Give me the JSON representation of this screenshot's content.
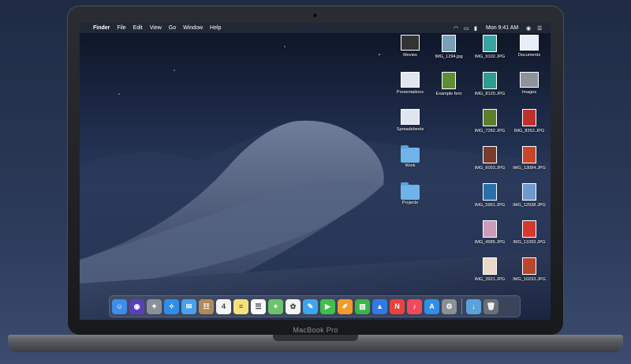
{
  "menubar": {
    "apple_glyph": "",
    "items": [
      "Finder",
      "File",
      "Edit",
      "View",
      "Go",
      "Window",
      "Help"
    ],
    "clock": "Mon 9:41 AM"
  },
  "desktop": {
    "col1": [
      {
        "label": "Movies",
        "kind": "movies"
      },
      {
        "label": "Presentations",
        "kind": "presentations"
      },
      {
        "label": "Spreadsheets",
        "kind": "spreadsheets"
      },
      {
        "label": "Work",
        "kind": "folder"
      },
      {
        "label": "Projects",
        "kind": "folder"
      }
    ],
    "col2": [
      {
        "label": "IMG_1294.jpg",
        "color": "#7aa0b6"
      },
      {
        "label": "Example fern",
        "color": "#5c8f35"
      }
    ],
    "col3": [
      {
        "label": "IMG_9102.JPG",
        "color": "#3aa3a0"
      },
      {
        "label": "IMG_8120.JPG",
        "color": "#2e9c8f"
      },
      {
        "label": "IMG_7282.JPG",
        "color": "#5d7f2a"
      },
      {
        "label": "IMG_6093.JPG",
        "color": "#7a3b2c"
      },
      {
        "label": "IMG_5961.JPG",
        "color": "#2b6fa8"
      },
      {
        "label": "IMG_4985.JPG",
        "color": "#c99db8"
      },
      {
        "label": "IMG_3921.JPG",
        "color": "#e9d8c8"
      }
    ],
    "col4": [
      {
        "label": "Documents",
        "kind": "documents"
      },
      {
        "label": "Images",
        "kind": "images"
      },
      {
        "label": "IMG_8352.JPG",
        "color": "#c0302a"
      },
      {
        "label": "IMG_13084.JPG",
        "color": "#c8452a"
      },
      {
        "label": "IMG_12938.JPG",
        "color": "#6e9ad0"
      },
      {
        "label": "IMG_11093.JPG",
        "color": "#d23a2e"
      },
      {
        "label": "IMG_10293.JPG",
        "color": "#b8462c"
      }
    ]
  },
  "dock": {
    "apps": [
      {
        "name": "finder-icon",
        "bg": "#3d8ee8",
        "glyph": "☺"
      },
      {
        "name": "siri-icon",
        "bg": "#5a3fb8",
        "glyph": "◉"
      },
      {
        "name": "launchpad-icon",
        "bg": "#8a8f99",
        "glyph": "✦"
      },
      {
        "name": "safari-icon",
        "bg": "#2f8fe6",
        "glyph": "✧"
      },
      {
        "name": "mail-icon",
        "bg": "#4aa0e8",
        "glyph": "✉"
      },
      {
        "name": "contacts-icon",
        "bg": "#b08a5a",
        "glyph": "☷"
      },
      {
        "name": "calendar-icon",
        "bg": "#f4f4f4",
        "glyph": "4"
      },
      {
        "name": "notes-icon",
        "bg": "#f6e27a",
        "glyph": "≡"
      },
      {
        "name": "reminders-icon",
        "bg": "#fafafa",
        "glyph": "☰"
      },
      {
        "name": "maps-icon",
        "bg": "#6cc36a",
        "glyph": "⌖"
      },
      {
        "name": "photos-icon",
        "bg": "#f3f3f3",
        "glyph": "✿"
      },
      {
        "name": "messages-icon",
        "bg": "#3ea4f0",
        "glyph": "✎"
      },
      {
        "name": "facetime-icon",
        "bg": "#3fbf4a",
        "glyph": "▶"
      },
      {
        "name": "pages-icon",
        "bg": "#f29a2e",
        "glyph": "✐"
      },
      {
        "name": "numbers-icon",
        "bg": "#3cb449",
        "glyph": "▥"
      },
      {
        "name": "keynote-icon",
        "bg": "#2f7be3",
        "glyph": "▲"
      },
      {
        "name": "news-icon",
        "bg": "#e9433b",
        "glyph": "N"
      },
      {
        "name": "music-icon",
        "bg": "#f04a5a",
        "glyph": "♪"
      },
      {
        "name": "app-store-icon",
        "bg": "#2f8fe8",
        "glyph": "A"
      },
      {
        "name": "system-preferences-icon",
        "bg": "#8b8f96",
        "glyph": "⚙"
      }
    ],
    "downloads": {
      "name": "downloads-folder-icon",
      "bg": "#5aa2dc",
      "glyph": "↓"
    },
    "trash": {
      "name": "trash-icon",
      "bg": "#6a6f78",
      "glyph": "🗑"
    }
  },
  "laptop_label": "MacBook Pro"
}
